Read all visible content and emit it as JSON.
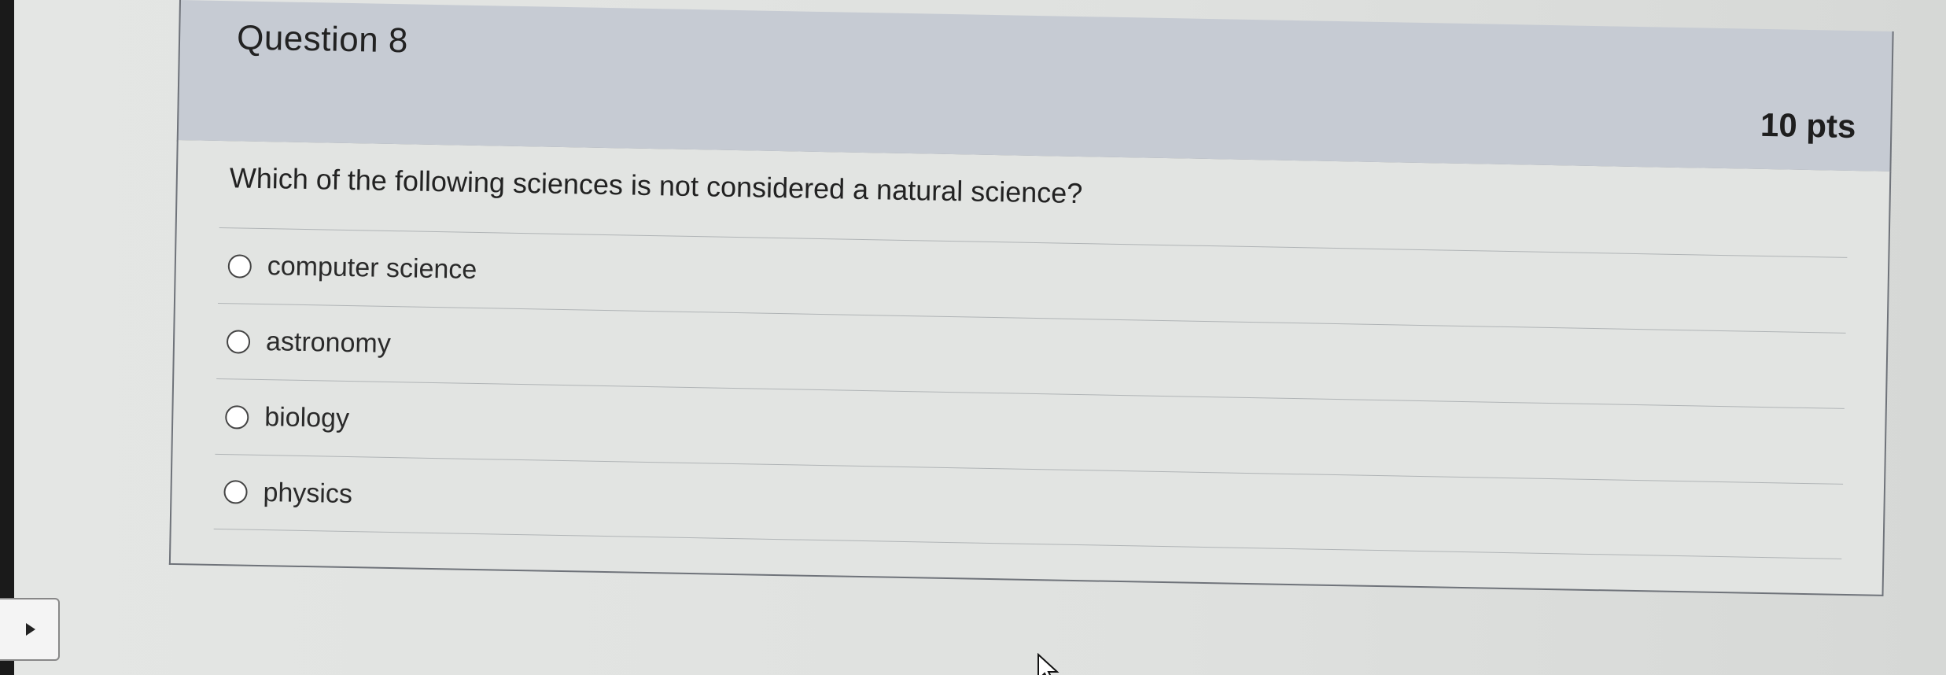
{
  "question": {
    "title": "Question 8",
    "points": "10 pts",
    "text": "Which of the following sciences is not considered a natural science?",
    "options": [
      {
        "label": "computer science",
        "selected": false
      },
      {
        "label": "astronomy",
        "selected": false
      },
      {
        "label": "biology",
        "selected": false
      },
      {
        "label": "physics",
        "selected": false
      }
    ]
  },
  "icons": {
    "expand": "play-triangle-icon",
    "cursor": "mouse-pointer-icon"
  }
}
